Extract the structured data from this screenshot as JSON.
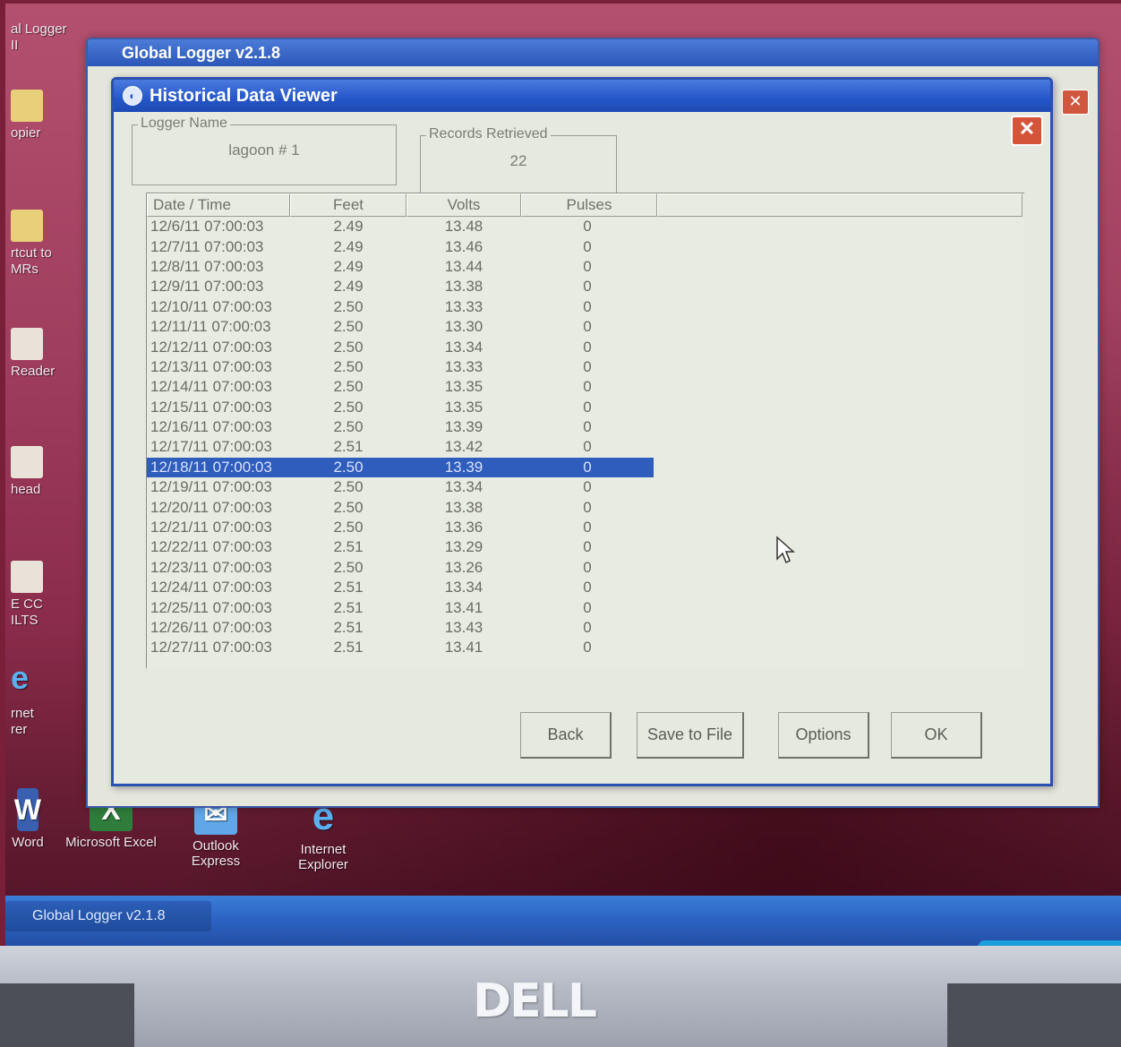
{
  "desktop": {
    "left_icons": [
      {
        "label": "al Logger\nII"
      },
      {
        "label": "opier"
      },
      {
        "label": "rtcut to\nMRs"
      },
      {
        "label": "Reader"
      },
      {
        "label": "head"
      },
      {
        "label": "E CC\nILTS"
      },
      {
        "label": "rnet\nrer"
      }
    ],
    "bottom_icons": [
      {
        "label": "Word",
        "icon": "word-icon"
      },
      {
        "label": "Microsoft Excel",
        "icon": "excel-icon"
      },
      {
        "label": "Outlook\nExpress",
        "icon": "outlook-express-icon"
      },
      {
        "label": "Internet\nExplorer",
        "icon": "internet-explorer-icon"
      }
    ]
  },
  "background_window": {
    "title": "Global Logger v2.1.8"
  },
  "dialog": {
    "title": "Historical Data Viewer",
    "logger_name_legend": "Logger Name",
    "logger_name_value": "lagoon # 1",
    "records_legend": "Records Retrieved",
    "records_value": "22",
    "columns": [
      "Date / Time",
      "Feet",
      "Volts",
      "Pulses"
    ],
    "rows": [
      [
        "12/6/11 07:00:03",
        "2.49",
        "13.48",
        "0"
      ],
      [
        "12/7/11 07:00:03",
        "2.49",
        "13.46",
        "0"
      ],
      [
        "12/8/11 07:00:03",
        "2.49",
        "13.44",
        "0"
      ],
      [
        "12/9/11 07:00:03",
        "2.49",
        "13.38",
        "0"
      ],
      [
        "12/10/11 07:00:03",
        "2.50",
        "13.33",
        "0"
      ],
      [
        "12/11/11 07:00:03",
        "2.50",
        "13.30",
        "0"
      ],
      [
        "12/12/11 07:00:03",
        "2.50",
        "13.34",
        "0"
      ],
      [
        "12/13/11 07:00:03",
        "2.50",
        "13.33",
        "0"
      ],
      [
        "12/14/11 07:00:03",
        "2.50",
        "13.35",
        "0"
      ],
      [
        "12/15/11 07:00:03",
        "2.50",
        "13.35",
        "0"
      ],
      [
        "12/16/11 07:00:03",
        "2.50",
        "13.39",
        "0"
      ],
      [
        "12/17/11 07:00:03",
        "2.51",
        "13.42",
        "0"
      ],
      [
        "12/18/11 07:00:03",
        "2.50",
        "13.39",
        "0"
      ],
      [
        "12/19/11 07:00:03",
        "2.50",
        "13.34",
        "0"
      ],
      [
        "12/20/11 07:00:03",
        "2.50",
        "13.38",
        "0"
      ],
      [
        "12/21/11 07:00:03",
        "2.50",
        "13.36",
        "0"
      ],
      [
        "12/22/11 07:00:03",
        "2.51",
        "13.29",
        "0"
      ],
      [
        "12/23/11 07:00:03",
        "2.50",
        "13.26",
        "0"
      ],
      [
        "12/24/11 07:00:03",
        "2.51",
        "13.34",
        "0"
      ],
      [
        "12/25/11 07:00:03",
        "2.51",
        "13.41",
        "0"
      ],
      [
        "12/26/11 07:00:03",
        "2.51",
        "13.43",
        "0"
      ],
      [
        "12/27/11 07:00:03",
        "2.51",
        "13.41",
        "0"
      ]
    ],
    "selected_row": 12,
    "buttons": {
      "back": "Back",
      "save": "Save to File",
      "options": "Options",
      "ok": "OK"
    }
  },
  "taskbar": {
    "active_task": "Global Logger v2.1.8"
  },
  "laptop": {
    "brand": "DELL"
  },
  "colors": {
    "titlebar": "#2556c8",
    "selection": "#2f5dbd",
    "dialog_bg": "#e6e9df",
    "wallpaper": "#a13f60"
  }
}
